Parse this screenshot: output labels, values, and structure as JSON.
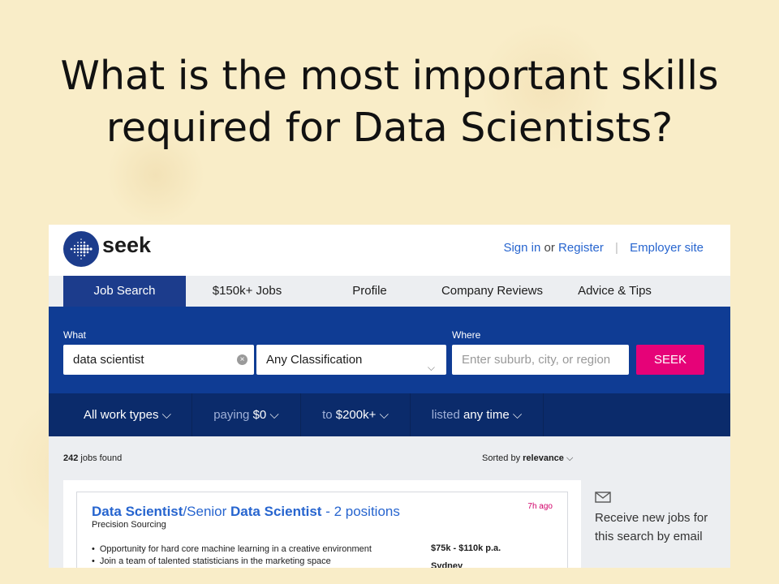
{
  "slide": {
    "title_line1": "What is the most important skills",
    "title_line2": "required for Data Scientists?"
  },
  "header": {
    "brand": "seek",
    "sign_in": "Sign in",
    "or": "or",
    "register": "Register",
    "separator": "|",
    "employer_site": "Employer site"
  },
  "nav": {
    "tabs": [
      {
        "label": "Job Search",
        "active": true
      },
      {
        "label": "$150k+ Jobs"
      },
      {
        "label": "Profile"
      },
      {
        "label": "Company Reviews"
      },
      {
        "label": "Advice & Tips"
      }
    ]
  },
  "search": {
    "what_label": "What",
    "what_value": "data scientist",
    "classification": "Any Classification",
    "where_label": "Where",
    "where_placeholder": "Enter suburb, city, or region",
    "seek_button": "SEEK"
  },
  "filters": {
    "work_types": "All work types",
    "paying_label": "paying",
    "paying_value": "$0",
    "to_label": "to",
    "to_value": "$200k+",
    "listed_label": "listed",
    "listed_value": "any time"
  },
  "results": {
    "count": "242",
    "count_suffix": "jobs found",
    "sorted_by_label": "Sorted by",
    "sorted_by_value": "relevance",
    "jobs": [
      {
        "title_part1": "Data Scientist",
        "title_part2": "/Senior ",
        "title_part3": "Data Scientist",
        "title_part4": " - 2 positions",
        "posted": "7h ago",
        "company": "Precision Sourcing",
        "bullets": [
          "Opportunity for hard core machine learning in a creative environment",
          "Join a team of talented statisticians in the marketing space"
        ],
        "salary": "$75k - $110k p.a.",
        "location": "Sydney"
      }
    ],
    "alert": "Receive new jobs for this search by email"
  },
  "colors": {
    "brand_blue": "#0f3c94",
    "filter_bar": "#0b2b6b",
    "link_blue": "#2765cf",
    "accent_pink": "#e60278"
  }
}
